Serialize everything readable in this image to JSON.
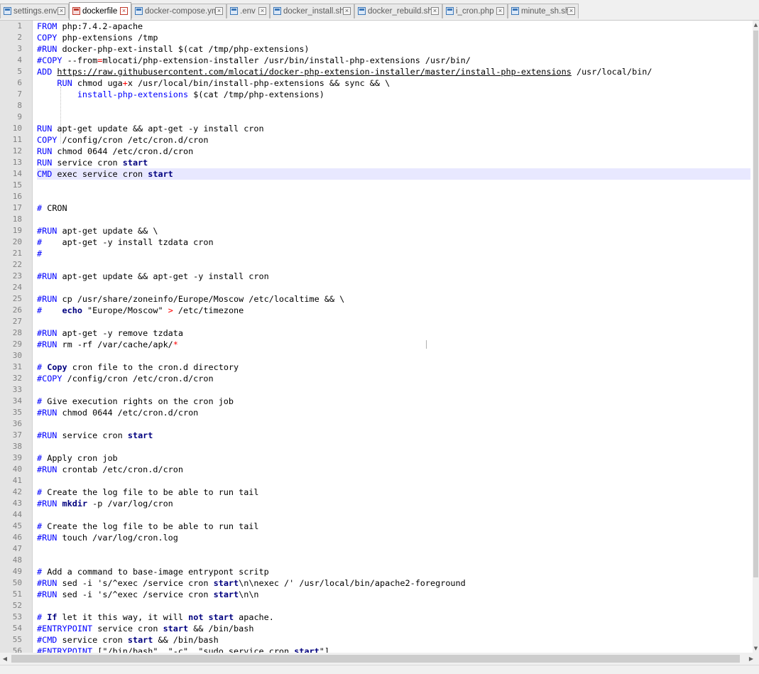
{
  "tabs": [
    {
      "label": "settings.env",
      "active": false
    },
    {
      "label": "dockerfile",
      "active": true
    },
    {
      "label": "docker-compose.yml",
      "active": false
    },
    {
      "label": ".env",
      "active": false
    },
    {
      "label": "docker_install.sh",
      "active": false
    },
    {
      "label": "docker_rebuild.sh",
      "active": false
    },
    {
      "label": "i_cron.php",
      "active": false
    },
    {
      "label": "minute_sh.sh",
      "active": false
    }
  ],
  "editor": {
    "current_line": 14,
    "lines": [
      "FROM php:7.4.2-apache",
      "COPY php-extensions /tmp",
      "#RUN docker-php-ext-install $(cat /tmp/php-extensions)",
      "#COPY --from=mlocati/php-extension-installer /usr/bin/install-php-extensions /usr/bin/",
      "ADD https://raw.githubusercontent.com/mlocati/docker-php-extension-installer/master/install-php-extensions /usr/local/bin/",
      "    RUN chmod uga+x /usr/local/bin/install-php-extensions && sync && \\",
      "        install-php-extensions $(cat /tmp/php-extensions)",
      "",
      "",
      "RUN apt-get update && apt-get -y install cron",
      "COPY /config/cron /etc/cron.d/cron",
      "RUN chmod 0644 /etc/cron.d/cron",
      "RUN service cron start",
      "CMD exec service cron start",
      "",
      "",
      "# CRON",
      "",
      "#RUN apt-get update && \\",
      "#    apt-get -y install tzdata cron",
      "#",
      "",
      "#RUN apt-get update && apt-get -y install cron",
      "",
      "#RUN cp /usr/share/zoneinfo/Europe/Moscow /etc/localtime && \\",
      "#    echo \"Europe/Moscow\" > /etc/timezone",
      "",
      "#RUN apt-get -y remove tzdata",
      "#RUN rm -rf /var/cache/apk/*",
      "",
      "# Copy cron file to the cron.d directory",
      "#COPY /config/cron /etc/cron.d/cron",
      "",
      "# Give execution rights on the cron job",
      "#RUN chmod 0644 /etc/cron.d/cron",
      "",
      "#RUN service cron start",
      "",
      "# Apply cron job",
      "#RUN crontab /etc/cron.d/cron",
      "",
      "# Create the log file to be able to run tail",
      "#RUN mkdir -p /var/log/cron",
      "",
      "# Create the log file to be able to run tail",
      "#RUN touch /var/log/cron.log",
      "",
      "",
      "# Add a command to base-image entrypont scritp",
      "#RUN sed -i 's/^exec /service cron start\\n\\nexec /' /usr/local/bin/apache2-foreground",
      "#RUN sed -i 's/^exec /service cron start\\n\\n",
      "",
      "# If let it this way, it will not start apache.",
      "#ENTRYPOINT service cron start && /bin/bash",
      "#CMD service cron start && /bin/bash",
      "#ENTRYPOINT [\"/bin/bash\", \"-c\", \"sudo service cron start\"]"
    ]
  },
  "colors": {
    "keyword": "#0000ff",
    "bold_keyword": "#00007f",
    "operator": "#ff0000",
    "current_line_bg": "#e8e8ff",
    "gutter_bg": "#e4e4e4"
  }
}
